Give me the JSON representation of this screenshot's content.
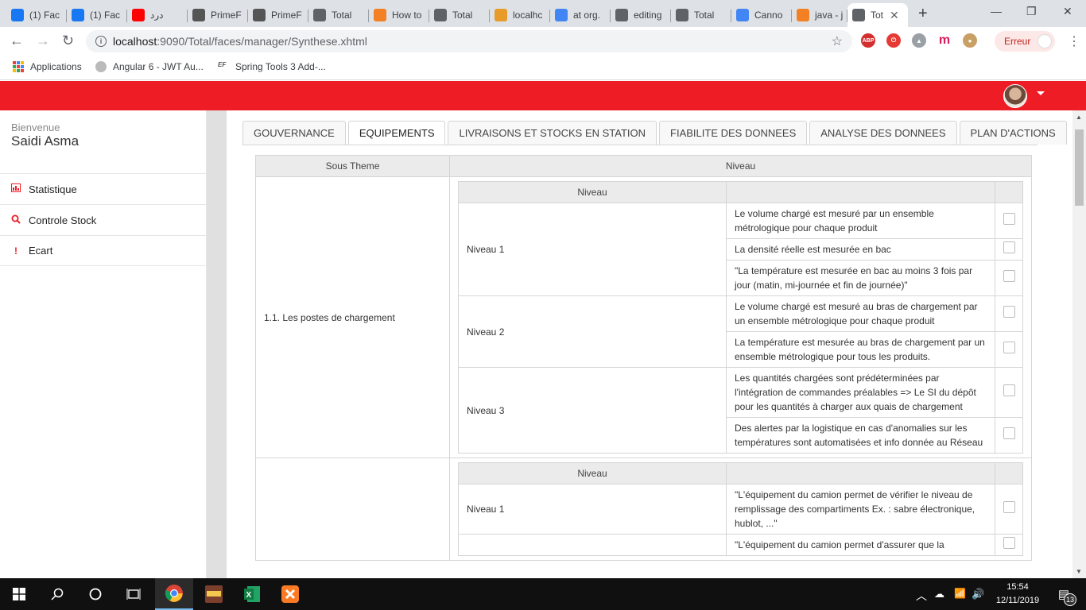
{
  "browser": {
    "tabs": [
      {
        "title": "(1) Fac",
        "icon": "facebook-icon",
        "color": "#1877f2"
      },
      {
        "title": "(1) Fac",
        "icon": "facebook-icon",
        "color": "#1877f2"
      },
      {
        "title": "درد",
        "icon": "youtube-icon",
        "color": "#ff0000"
      },
      {
        "title": "PrimeF",
        "icon": "primefaces-icon",
        "color": "#555555"
      },
      {
        "title": "PrimeF",
        "icon": "primefaces-icon",
        "color": "#555555"
      },
      {
        "title": "Total",
        "icon": "globe-icon",
        "color": "#5f6368"
      },
      {
        "title": "How to",
        "icon": "stackoverflow-icon",
        "color": "#f48024"
      },
      {
        "title": "Total",
        "icon": "globe-icon",
        "color": "#5f6368"
      },
      {
        "title": "localhc",
        "icon": "phpmyadmin-icon",
        "color": "#e69b2b"
      },
      {
        "title": "at org.",
        "icon": "google-icon",
        "color": "#4285f4"
      },
      {
        "title": "editing",
        "icon": "globe-icon",
        "color": "#5f6368"
      },
      {
        "title": "Total",
        "icon": "globe-icon",
        "color": "#5f6368"
      },
      {
        "title": "Canno",
        "icon": "google-icon",
        "color": "#4285f4"
      },
      {
        "title": "java - j",
        "icon": "stackoverflow-icon",
        "color": "#f48024"
      },
      {
        "title": "Tot",
        "icon": "globe-icon",
        "color": "#5f6368",
        "active": true
      }
    ],
    "url_host": "localhost",
    "url_path": ":9090/Total/faces/manager/Synthese.xhtml",
    "profile_error": "Erreur",
    "bookmarks": [
      {
        "label": "Applications",
        "icon": "apps-grid-icon"
      },
      {
        "label": "Angular 6 - JWT Au...",
        "icon": "bookmark-favicon-icon"
      },
      {
        "label": "Spring Tools 3 Add-...",
        "icon": "eclipse-favicon-icon"
      }
    ]
  },
  "app": {
    "brand_color": "#ee1c25",
    "sidebar": {
      "welcome": "Bienvenue",
      "user": "Saidi Asma",
      "items": [
        {
          "label": "Statistique",
          "icon": "bar-chart-icon"
        },
        {
          "label": "Controle Stock",
          "icon": "search-icon"
        },
        {
          "label": "Ecart",
          "icon": "exclamation-icon"
        }
      ]
    },
    "tabs": [
      {
        "label": "GOUVERNANCE"
      },
      {
        "label": "EQUIPEMENTS",
        "active": true
      },
      {
        "label": "LIVRAISONS ET STOCKS EN STATION"
      },
      {
        "label": "FIABILITE DES DONNEES"
      },
      {
        "label": "ANALYSE DES DONNEES"
      },
      {
        "label": "PLAN D'ACTIONS"
      }
    ],
    "table": {
      "col_theme": "Sous Theme",
      "col_niveau": "Niveau",
      "inner_col_niveau": "Niveau",
      "groups": [
        {
          "theme": "1.1. Les postes de chargement",
          "levels": [
            {
              "name": "Niveau 1",
              "criteria": [
                {
                  "text": "Le volume chargé est mesuré par un ensemble métrologique pour chaque produit",
                  "checked": false
                },
                {
                  "text": "La densité réelle est mesurée en bac",
                  "checked": false
                },
                {
                  "text": "\"La température est mesurée en bac au moins 3 fois par jour (matin, mi-journée et fin de journée)\"",
                  "checked": false
                }
              ]
            },
            {
              "name": "Niveau 2",
              "criteria": [
                {
                  "text": "Le volume chargé est mesuré au bras de chargement par un ensemble métrologique pour chaque produit",
                  "checked": false
                },
                {
                  "text": "La température est mesurée au bras de chargement par un ensemble métrologique pour tous les produits.",
                  "checked": false
                }
              ]
            },
            {
              "name": "Niveau 3",
              "criteria": [
                {
                  "text": "Les quantités chargées sont prédéterminées par l'intégration de commandes préalables => Le SI du dépôt pour les quantités à charger aux quais de chargement",
                  "checked": false
                },
                {
                  "text": "Des alertes par la logistique en cas d'anomalies sur les températures sont automatisées et info donnée au Réseau",
                  "checked": false
                }
              ]
            }
          ]
        },
        {
          "theme": "",
          "levels": [
            {
              "name": "Niveau 1",
              "criteria": [
                {
                  "text": "\"L'équipement du camion permet de vérifier le niveau de remplissage des compartiments Ex. : sabre électronique, hublot, ...\"",
                  "checked": false
                }
              ]
            },
            {
              "name": "",
              "criteria": [
                {
                  "text": "\"L'équipement du camion permet d'assurer que la",
                  "checked": false
                }
              ]
            }
          ]
        }
      ]
    }
  },
  "taskbar": {
    "apps": [
      {
        "icon": "chrome-icon",
        "active": true
      },
      {
        "icon": "eagle-app-icon"
      },
      {
        "icon": "excel-icon"
      },
      {
        "icon": "xampp-icon"
      }
    ],
    "time": "15:54",
    "date": "12/11/2019",
    "notifications": "13"
  }
}
